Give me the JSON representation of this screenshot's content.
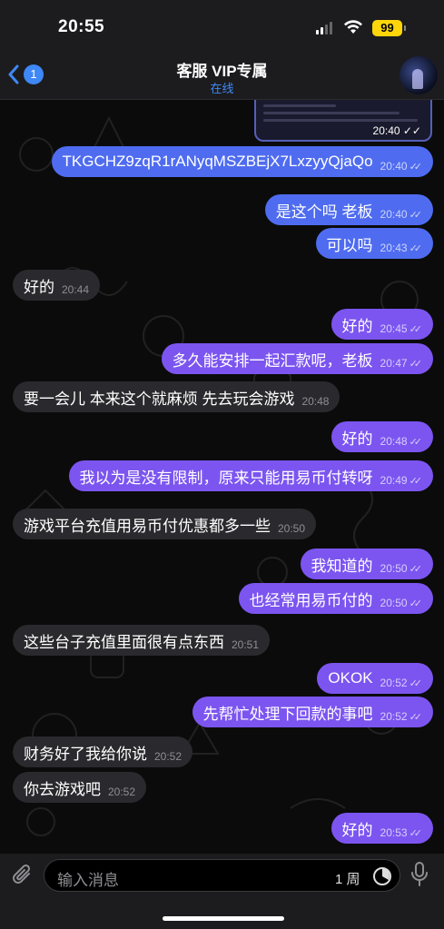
{
  "status": {
    "time": "20:55",
    "battery": "99"
  },
  "header": {
    "back_count": "1",
    "title": "客服 VIP专属",
    "subtitle": "在线"
  },
  "messages": [
    {
      "dir": "out",
      "text": "TKGCHZ9zqR1rANyqMSZBEjX7LxzyyQjaQo",
      "time": "20:40",
      "style": "blue"
    },
    {
      "dir": "out",
      "text": "是这个吗 老板",
      "time": "20:40",
      "style": "blue"
    },
    {
      "dir": "out",
      "text": "可以吗",
      "time": "20:43",
      "style": "blue"
    },
    {
      "dir": "in",
      "text": "好的",
      "time": "20:44"
    },
    {
      "dir": "out",
      "text": "好的",
      "time": "20:45"
    },
    {
      "dir": "out",
      "text": "多久能安排一起汇款呢，老板",
      "time": "20:47"
    },
    {
      "dir": "in",
      "text": "要一会儿  本来这个就麻烦  先去玩会游戏",
      "time": "20:48"
    },
    {
      "dir": "out",
      "text": "好的",
      "time": "20:48"
    },
    {
      "dir": "out",
      "text": "我以为是没有限制，原来只能用易币付转呀",
      "time": "20:49"
    },
    {
      "dir": "in",
      "text": "游戏平台充值用易币付优惠都多一些",
      "time": "20:50"
    },
    {
      "dir": "out",
      "text": "我知道的",
      "time": "20:50"
    },
    {
      "dir": "out",
      "text": "也经常用易币付的",
      "time": "20:50"
    },
    {
      "dir": "in",
      "text": "这些台子充值里面很有点东西",
      "time": "20:51"
    },
    {
      "dir": "out",
      "text": "OKOK",
      "time": "20:52"
    },
    {
      "dir": "out",
      "text": "先帮忙处理下回款的事吧",
      "time": "20:52"
    },
    {
      "dir": "in",
      "text": "财务好了我给你说",
      "time": "20:52"
    },
    {
      "dir": "in",
      "text": "你去游戏吧",
      "time": "20:52"
    },
    {
      "dir": "out",
      "text": "好的",
      "time": "20:53"
    }
  ],
  "image_message": {
    "time": "20:40"
  },
  "input": {
    "placeholder": "输入消息",
    "timer_label": "1 周"
  },
  "colors": {
    "outgoing": "#7c55f0",
    "outgoing_blue": "#4f6cf0",
    "incoming": "#2a2a2e",
    "accent": "#3e88f7"
  }
}
